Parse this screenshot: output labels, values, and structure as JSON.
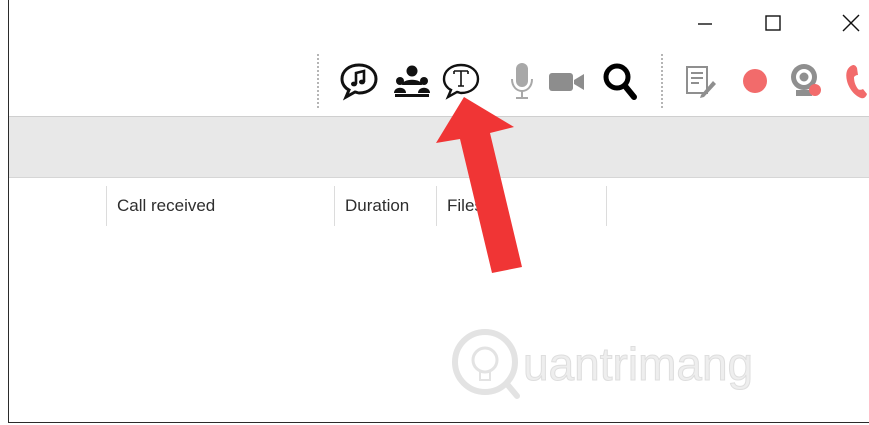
{
  "titlebar": {
    "minimize_label": "—",
    "maximize_label": "☐",
    "close_label": "✕"
  },
  "toolbar": {
    "tools": [
      {
        "icon": "music-chat-icon"
      },
      {
        "icon": "group-icon"
      },
      {
        "icon": "text-chat-icon"
      },
      {
        "icon": "microphone-icon"
      },
      {
        "icon": "video-camera-icon"
      },
      {
        "icon": "search-icon"
      },
      {
        "icon": "notes-icon"
      },
      {
        "icon": "record-icon"
      },
      {
        "icon": "webcam-record-icon"
      },
      {
        "icon": "phone-icon"
      }
    ]
  },
  "list": {
    "columns": [
      "Call received",
      "Duration",
      "Files"
    ]
  },
  "watermark": {
    "text": "uantrimang"
  },
  "colors": {
    "red": "#f03535",
    "record": "#f26b6b",
    "icon_dark": "#111111",
    "icon_grey": "#9a9a9a"
  }
}
